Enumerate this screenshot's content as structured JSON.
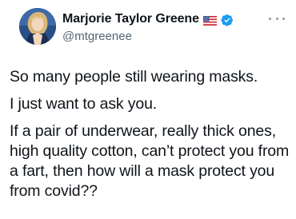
{
  "author": {
    "display_name": "Marjorie Taylor Greene",
    "handle": "@mtgreenee",
    "icons": [
      "us-flag-icon",
      "verified-badge-icon",
      "more-options-icon"
    ]
  },
  "tweet": {
    "paragraphs": [
      "So many people still wearing masks.",
      "I just want to ask you.",
      "If a pair of underwear, really thick ones, high quality cotton, can’t protect you from a fart, then how will a mask protect you from covid??"
    ]
  },
  "colors": {
    "text": "#0f1419",
    "secondary": "#536471",
    "verified": "#1d9bf0",
    "background": "#ffffff"
  }
}
